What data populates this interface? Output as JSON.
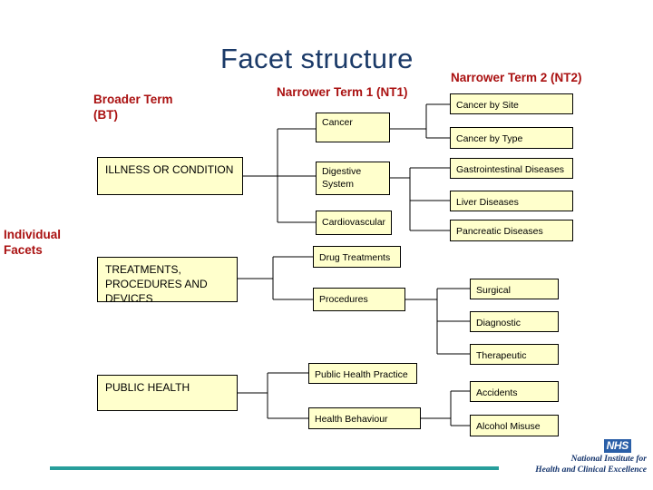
{
  "slide": {
    "title": "Facet structure",
    "headers": {
      "bt": "Broader Term\n(BT)",
      "bt_line1": "Broader Term",
      "bt_line2": "(BT)",
      "nt1": "Narrower Term 1 (NT1)",
      "nt2": "Narrower Term 2 (NT2)",
      "facets_line1": "Individual",
      "facets_line2": "Facets"
    },
    "colors": {
      "title": "#1b3a68",
      "header_red": "#aa1111",
      "node_fill": "#ffffcc",
      "node_border": "#000000",
      "rule_teal": "#279e9b",
      "nhs_blue": "#2a5fa8"
    },
    "nodes": {
      "illness": "ILLNESS OR CONDITION",
      "treatments": "TREATMENTS, PROCEDURES AND DEVICES",
      "public_health": "PUBLIC HEALTH",
      "cancer": "Cancer",
      "digestive": "Digestive System",
      "digestive_line1": "Digestive",
      "digestive_line2": "System",
      "cardiovascular": "Cardiovascular",
      "drug_treatments": "Drug Treatments",
      "procedures": "Procedures",
      "public_health_practice": "Public Health Practice",
      "health_behaviour": "Health Behaviour",
      "cancer_by_site": "Cancer by Site",
      "cancer_by_type": "Cancer by Type",
      "gastrointestinal": "Gastrointestinal Diseases",
      "liver": "Liver Diseases",
      "pancreatic": "Pancreatic Diseases",
      "surgical": "Surgical",
      "diagnostic": "Diagnostic",
      "therapeutic": "Therapeutic",
      "accidents": "Accidents",
      "alcohol_misuse": "Alcohol Misuse"
    },
    "treatments_lines": {
      "l1": "TREATMENTS,",
      "l2": "PROCEDURES AND",
      "l3": "DEVICES"
    },
    "logo": {
      "badge": "NHS",
      "line1": "National Institute for",
      "line2": "Health and Clinical Excellence"
    }
  }
}
